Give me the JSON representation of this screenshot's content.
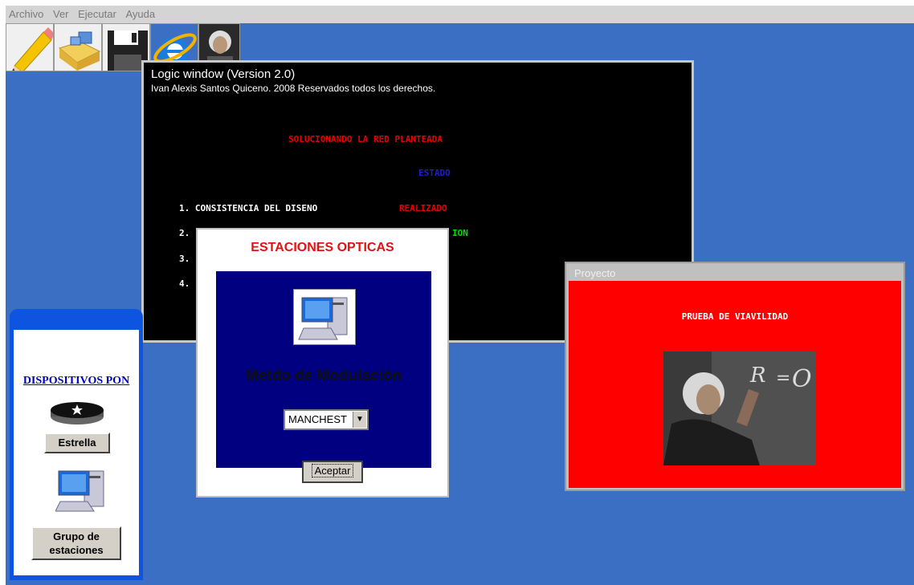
{
  "menu": {
    "items": [
      "Archivo",
      "Ver",
      "Ejecutar",
      "Ayuda"
    ]
  },
  "toolbar": {
    "buttons": [
      "pencil-icon",
      "folder-icon",
      "floppy-disk-icon",
      "internet-explorer-icon",
      "einstein-photo-icon"
    ]
  },
  "logic_window": {
    "title": "Logic window (Version 2.0)",
    "copyright": "Ivan Alexis Santos Quiceno.  2008   Reservados todos los derechos.",
    "heading": "SOLUCIONANDO LA RED PLANTEADA",
    "status_header": "ESTADO",
    "rows": [
      {
        "label": "1. CONSISTENCIA DEL DISENO",
        "status": "REALIZADO",
        "status_color": "#e80000"
      },
      {
        "label": "2. ",
        "status": "ION",
        "status_color": "#00e000"
      },
      {
        "label": "3. ",
        "status": "",
        "status_color": "#ffffff"
      },
      {
        "label": "4. ",
        "status": "",
        "status_color": "#ffffff"
      }
    ]
  },
  "sidebar": {
    "title": "DISPOSITIVOS PON",
    "buttons": {
      "estrella": "Estrella",
      "grupo": "Grupo de estaciones"
    }
  },
  "dialog": {
    "title": "ESTACIONES OPTICAS",
    "label": "Metdo de Modulación",
    "select_value": "MANCHEST",
    "accept": "Aceptar"
  },
  "project_window": {
    "caption": "Proyecto",
    "title": "PRUEBA DE VIAVILIDAD"
  },
  "colors": {
    "desktop": "#3a6fc4",
    "dialog_panel": "#000080",
    "project_bg": "#ff0000",
    "sidebar_frame": "#0d55e0"
  }
}
